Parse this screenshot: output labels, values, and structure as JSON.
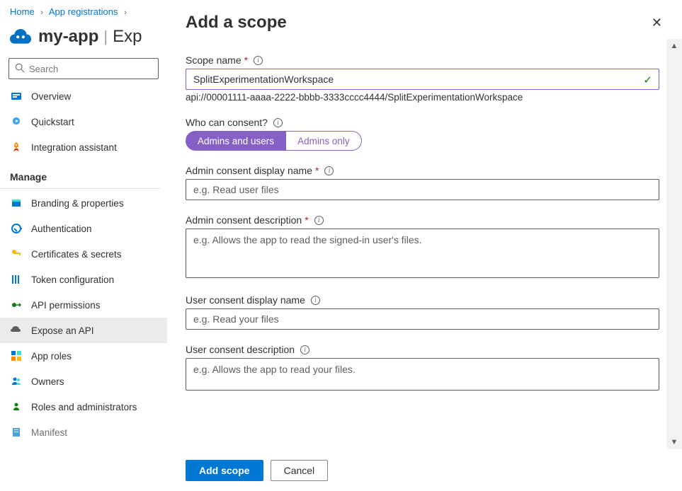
{
  "breadcrumb": {
    "home": "Home",
    "appreg": "App registrations"
  },
  "page": {
    "app_name": "my-app",
    "section": "Exp"
  },
  "search": {
    "placeholder": "Search"
  },
  "nav": {
    "overview": "Overview",
    "quickstart": "Quickstart",
    "integration": "Integration assistant",
    "manage_header": "Manage",
    "branding": "Branding & properties",
    "authentication": "Authentication",
    "certificates": "Certificates & secrets",
    "token": "Token configuration",
    "permissions": "API permissions",
    "expose": "Expose an API",
    "approles": "App roles",
    "owners": "Owners",
    "roles": "Roles and administrators",
    "manifest": "Manifest"
  },
  "panel": {
    "title": "Add a scope",
    "scope_name_label": "Scope name",
    "scope_name_value": "SplitExperimentationWorkspace",
    "scope_uri": "api://00001111-aaaa-2222-bbbb-3333cccc4444/SplitExperimentationWorkspace",
    "consent_label": "Who can consent?",
    "consent_opt1": "Admins and users",
    "consent_opt2": "Admins only",
    "admin_display_label": "Admin consent display name",
    "admin_display_ph": "e.g. Read user files",
    "admin_desc_label": "Admin consent description",
    "admin_desc_ph": "e.g. Allows the app to read the signed-in user's files.",
    "user_display_label": "User consent display name",
    "user_display_ph": "e.g. Read your files",
    "user_desc_label": "User consent description",
    "user_desc_ph": "e.g. Allows the app to read your files.",
    "add_btn": "Add scope",
    "cancel_btn": "Cancel"
  }
}
